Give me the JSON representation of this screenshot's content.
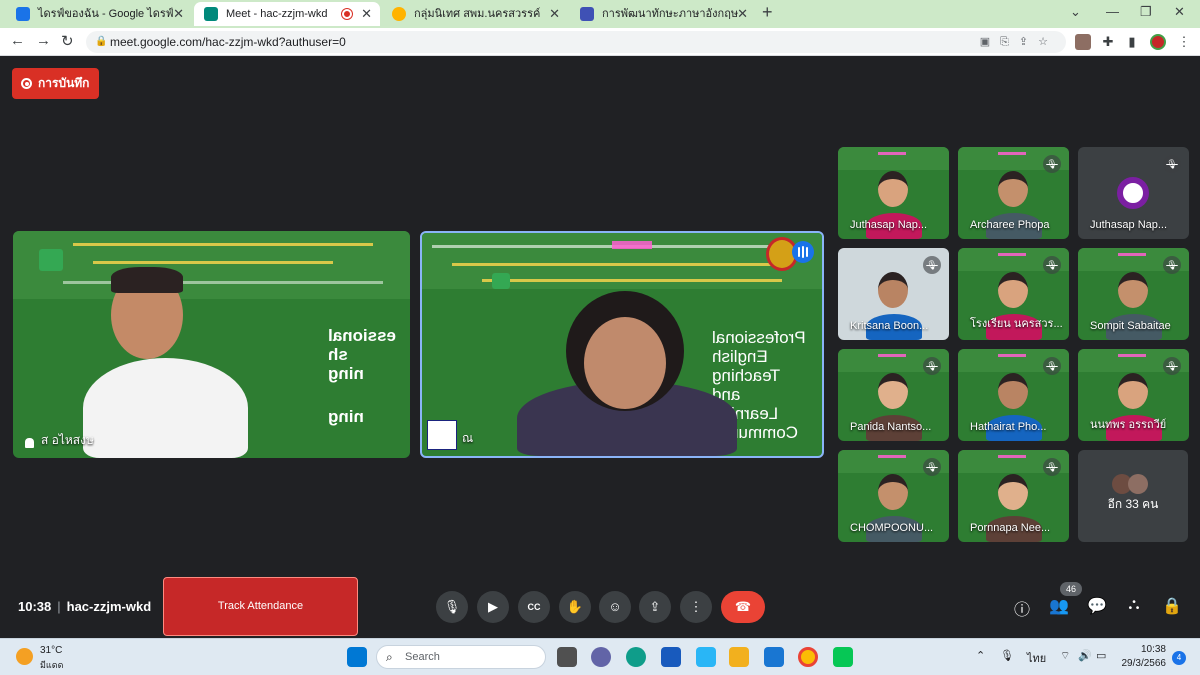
{
  "browser": {
    "tabs": [
      {
        "title": "ไดรฟ์ของฉัน - Google ไดรฟ์",
        "color": "#1a73e8"
      },
      {
        "title": "Meet - hac-zzjm-wkd",
        "color": "#00897b"
      },
      {
        "title": "กลุ่มนิเทศ สพม.นครสวรรค์",
        "color": "#ffb300"
      },
      {
        "title": "การพัฒนาทักษะภาษาอังกฤษ English",
        "color": "#3f51b5"
      }
    ],
    "url": "meet.google.com/hac-zzjm-wkd?authuser=0"
  },
  "meet": {
    "record_label": "การบันทึก",
    "main_tiles": [
      {
        "name": "ส อไหสงษ",
        "slide_lines": [
          "essional",
          "sh",
          "ning",
          "ning"
        ]
      },
      {
        "name": "ณ",
        "slide_lines": [
          "Professional",
          "English",
          "Teaching",
          "and",
          "Learning",
          "Community"
        ]
      }
    ],
    "grid_tiles": [
      {
        "name": "Juthasap Nap...",
        "muted": false,
        "kind": "green"
      },
      {
        "name": "Archaree Phopa",
        "muted": true,
        "kind": "green"
      },
      {
        "name": "Juthasap Nap...",
        "muted": true,
        "kind": "dark"
      },
      {
        "name": "Kritsana Boon...",
        "muted": true,
        "kind": "room"
      },
      {
        "name": "โรงเรียน นครสวร...",
        "muted": true,
        "kind": "green"
      },
      {
        "name": "Sompit Sabaitae",
        "muted": true,
        "kind": "green"
      },
      {
        "name": "Panida Nantso...",
        "muted": true,
        "kind": "green"
      },
      {
        "name": "Hathairat Pho...",
        "muted": true,
        "kind": "green"
      },
      {
        "name": "นนทพร อรรถวีย์",
        "muted": true,
        "kind": "green"
      },
      {
        "name": "CHOMPOONU...",
        "muted": true,
        "kind": "green"
      },
      {
        "name": "Pornnapa Nee...",
        "muted": true,
        "kind": "green"
      }
    ],
    "more_label": "อีก 33 คน",
    "time": "10:38",
    "meeting_code": "hac-zzjm-wkd",
    "track_attendance_label": "Track Attendance",
    "participant_count": "46"
  },
  "taskbar": {
    "temperature": "31°C",
    "condition": "มีแดด",
    "search_placeholder": "Search",
    "language": "ไทย",
    "time": "10:38",
    "date": "29/3/2566",
    "notification_count": "4"
  }
}
